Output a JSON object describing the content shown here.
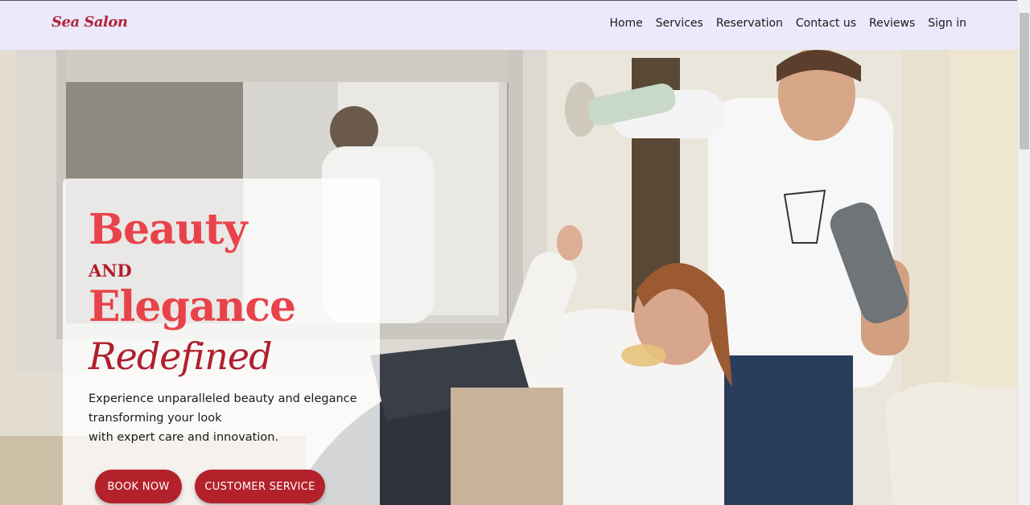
{
  "nav": {
    "brand": "Sea Salon",
    "links": [
      "Home",
      "Services",
      "Reservation",
      "Contact us",
      "Reviews",
      "Sign in"
    ]
  },
  "hero": {
    "line1": "Beauty",
    "line2": "AND",
    "line3": "Elegance",
    "line4": "Redefined",
    "description": [
      "Experience unparalleled beauty and elegance",
      "transforming your look",
      "with expert care and innovation."
    ],
    "book_button": "BOOK NOW",
    "service_button": "CUSTOMER SERVICE"
  },
  "colors": {
    "accent_red": "#e8434a",
    "dark_red": "#b01e2e",
    "button_red": "#b3212b",
    "nav_bg": "#ebe9fb"
  },
  "image": {
    "subject": "salon-hero-photo"
  }
}
